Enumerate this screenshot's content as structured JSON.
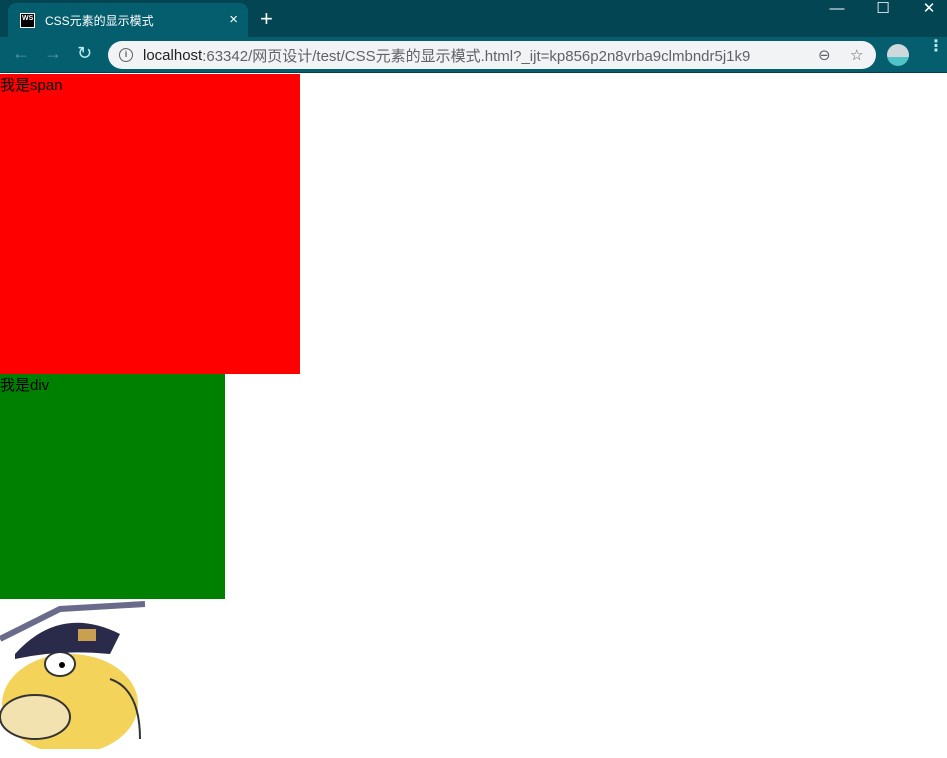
{
  "tab": {
    "icon_text": "WS",
    "title": "CSS元素的显示模式",
    "close": "×",
    "new_tab": "+"
  },
  "window": {
    "minimize": "—",
    "maximize": "☐",
    "close": "✕"
  },
  "toolbar": {
    "back": "←",
    "forward": "→",
    "reload": "↻",
    "url_host": "localhost",
    "url_rest": ":63342/网页设计/test/CSS元素的显示模式.html?_ijt=kp856p2n8vrba9clmbndr5j1k9",
    "zoom": "⊖",
    "bookmark": "☆",
    "menu": "⋮"
  },
  "page": {
    "span_text": "我是span",
    "div_text": "我是div"
  },
  "colors": {
    "span_bg": "#ff0000",
    "div_bg": "#008000"
  }
}
